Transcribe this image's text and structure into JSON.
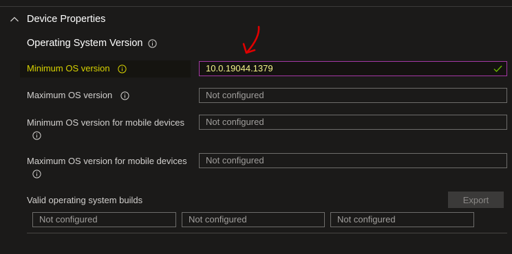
{
  "section": {
    "title": "Device Properties",
    "expanded": true
  },
  "group": {
    "title": "Operating System Version"
  },
  "rows": [
    {
      "label": "Minimum OS version",
      "value": "10.0.19044.1379",
      "placeholder": "Not configured",
      "valid": true
    },
    {
      "label": "Maximum OS version",
      "value": "",
      "placeholder": "Not configured"
    },
    {
      "label": "Minimum OS version for mobile devices",
      "value": "",
      "placeholder": "Not configured"
    },
    {
      "label": "Maximum OS version for mobile devices",
      "value": "",
      "placeholder": "Not configured"
    }
  ],
  "builds": {
    "label": "Valid operating system builds",
    "export_label": "Export",
    "fields": [
      {
        "placeholder": "Not configured"
      },
      {
        "placeholder": "Not configured"
      },
      {
        "placeholder": "Not configured"
      }
    ]
  },
  "colors": {
    "background": "#1b1a19",
    "highlight_label": "#d7d200",
    "active_border": "#a538a5",
    "annotation_arrow": "#e00000",
    "valid_check": "#6bb700"
  },
  "icons": {
    "chevron": "chevron-up-icon",
    "info": "info-icon",
    "check": "checkmark-icon",
    "annotation": "red-arrow-annotation"
  }
}
